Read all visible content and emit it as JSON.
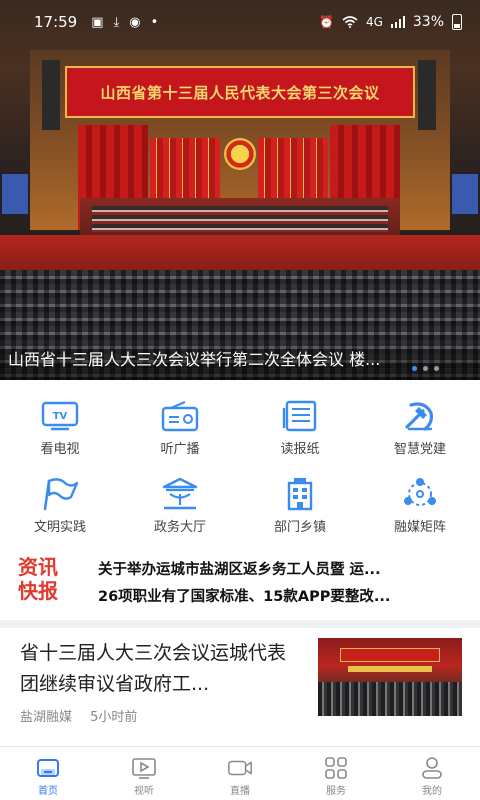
{
  "status_bar": {
    "time": "17:59",
    "network": "4G",
    "battery": "33%"
  },
  "banner": {
    "venue_banner_text": "山西省第十三届人民代表大会第三次会议",
    "caption": "山西省十三届人大三次会议举行第二次全体会议 楼...",
    "slide_count": 3,
    "active_slide": 1
  },
  "grid": {
    "items": [
      {
        "label": "看电视",
        "icon": "tv-icon"
      },
      {
        "label": "听广播",
        "icon": "radio-icon"
      },
      {
        "label": "读报纸",
        "icon": "newspaper-icon"
      },
      {
        "label": "智慧党建",
        "icon": "party-emblem-icon"
      },
      {
        "label": "文明实践",
        "icon": "flag-icon"
      },
      {
        "label": "政务大厅",
        "icon": "government-hall-icon"
      },
      {
        "label": "部门乡镇",
        "icon": "building-icon"
      },
      {
        "label": "融媒矩阵",
        "icon": "network-icon"
      }
    ]
  },
  "flash": {
    "logo_line1": "资讯",
    "logo_line2": "快报",
    "headline1": "关于举办运城市盐湖区返乡务工人员暨 运...",
    "headline2": "26项职业有了国家标准、15款APP要整改..."
  },
  "news": {
    "title": "省十三届人大三次会议运城代表团继续审议省政府工...",
    "source": "盐湖融媒",
    "time": "5小时前"
  },
  "tabbar": {
    "tabs": [
      {
        "label": "首页",
        "icon": "home-icon",
        "active": true
      },
      {
        "label": "视听",
        "icon": "play-icon",
        "active": false
      },
      {
        "label": "直播",
        "icon": "camera-icon",
        "active": false
      },
      {
        "label": "服务",
        "icon": "grid-icon",
        "active": false
      },
      {
        "label": "我的",
        "icon": "user-icon",
        "active": false
      }
    ]
  },
  "colors": {
    "accent": "#3478f6",
    "icon_blue": "#3b8cf0",
    "flash_red": "#e03a2f"
  }
}
